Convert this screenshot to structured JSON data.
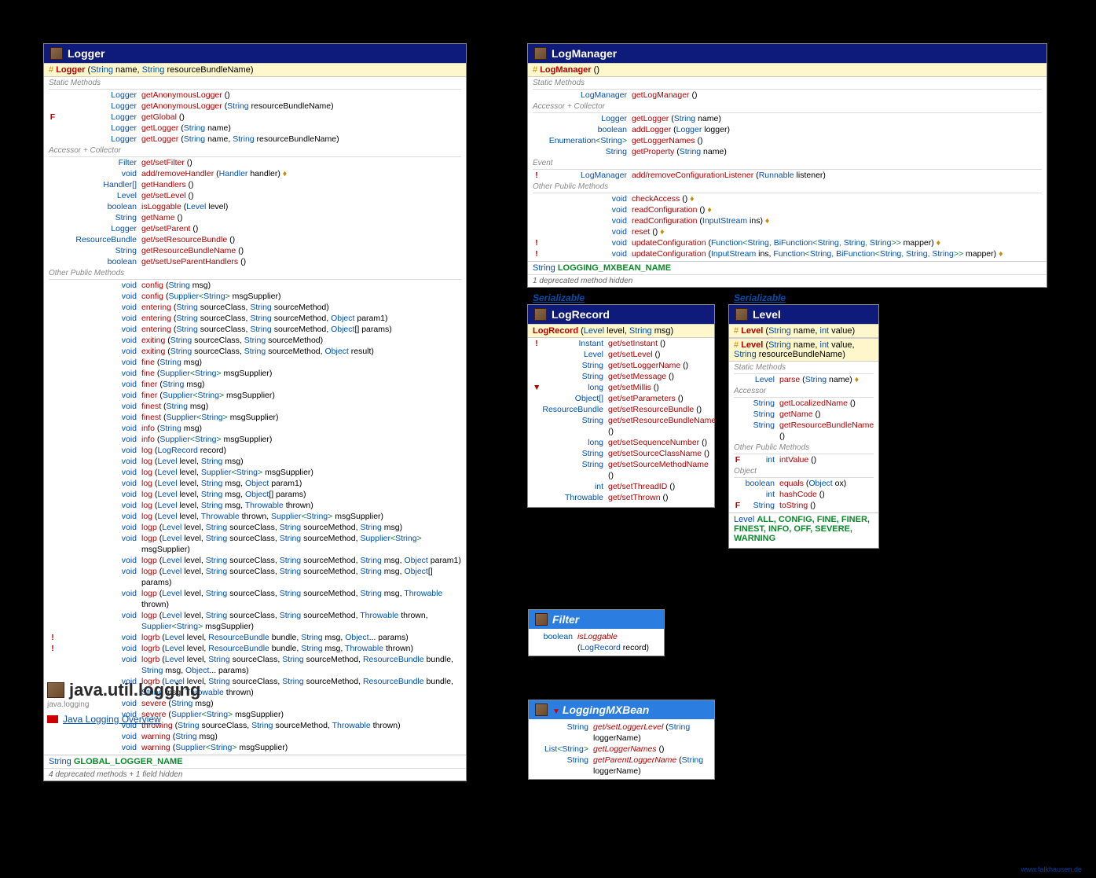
{
  "package": {
    "name": "java.util.logging",
    "module": "java.logging",
    "link": "Java Logging Overview"
  },
  "watermark": "www.falkhausen.de",
  "logger": {
    "title": "Logger",
    "ctors": [
      {
        "prefix": "#",
        "name": "Logger",
        "params": "(String name, String resourceBundleName)"
      }
    ],
    "sections": [
      {
        "title": "Static Methods",
        "rows": [
          {
            "m": "",
            "rt": "Logger",
            "name": "getAnonymousLogger",
            "params": " ()"
          },
          {
            "m": "",
            "rt": "Logger",
            "name": "getAnonymousLogger",
            "params": " (String resourceBundleName)"
          },
          {
            "m": "F",
            "rt": "Logger",
            "name": "getGlobal",
            "params": " ()"
          },
          {
            "m": "",
            "rt": "Logger",
            "name": "getLogger",
            "params": " (String name)"
          },
          {
            "m": "",
            "rt": "Logger",
            "name": "getLogger",
            "params": " (String name, String resourceBundleName)"
          }
        ]
      },
      {
        "title": "Accessor + Collector",
        "rows": [
          {
            "m": "",
            "rt": "Filter",
            "name": "get/setFilter",
            "params": " ()"
          },
          {
            "m": "",
            "rt": "void",
            "name": "add/removeHandler",
            "params": " (Handler handler) ♦"
          },
          {
            "m": "",
            "rt": "Handler[]",
            "name": "getHandlers",
            "params": " ()"
          },
          {
            "m": "",
            "rt": "Level",
            "name": "get/setLevel",
            "params": " ()"
          },
          {
            "m": "",
            "rt": "boolean",
            "name": "isLoggable",
            "params": " (Level level)"
          },
          {
            "m": "",
            "rt": "String",
            "name": "getName",
            "params": " ()"
          },
          {
            "m": "",
            "rt": "Logger",
            "name": "get/setParent",
            "params": " ()"
          },
          {
            "m": "",
            "rt": "ResourceBundle",
            "name": "get/setResourceBundle",
            "params": " ()"
          },
          {
            "m": "",
            "rt": "String",
            "name": "getResourceBundleName",
            "params": " ()"
          },
          {
            "m": "",
            "rt": "boolean",
            "name": "get/setUseParentHandlers",
            "params": " ()"
          }
        ]
      },
      {
        "title": "Other Public Methods",
        "rows": [
          {
            "m": "",
            "rt": "void",
            "name": "config",
            "params": " (String msg)"
          },
          {
            "m": "",
            "rt": "void",
            "name": "config",
            "params": " (Supplier<String> msgSupplier)"
          },
          {
            "m": "",
            "rt": "void",
            "name": "entering",
            "params": " (String sourceClass, String sourceMethod)"
          },
          {
            "m": "",
            "rt": "void",
            "name": "entering",
            "params": " (String sourceClass, String sourceMethod, Object param1)"
          },
          {
            "m": "",
            "rt": "void",
            "name": "entering",
            "params": " (String sourceClass, String sourceMethod, Object[] params)"
          },
          {
            "m": "",
            "rt": "void",
            "name": "exiting",
            "params": " (String sourceClass, String sourceMethod)"
          },
          {
            "m": "",
            "rt": "void",
            "name": "exiting",
            "params": " (String sourceClass, String sourceMethod, Object result)"
          },
          {
            "m": "",
            "rt": "void",
            "name": "fine",
            "params": " (String msg)"
          },
          {
            "m": "",
            "rt": "void",
            "name": "fine",
            "params": " (Supplier<String> msgSupplier)"
          },
          {
            "m": "",
            "rt": "void",
            "name": "finer",
            "params": " (String msg)"
          },
          {
            "m": "",
            "rt": "void",
            "name": "finer",
            "params": " (Supplier<String> msgSupplier)"
          },
          {
            "m": "",
            "rt": "void",
            "name": "finest",
            "params": " (String msg)"
          },
          {
            "m": "",
            "rt": "void",
            "name": "finest",
            "params": " (Supplier<String> msgSupplier)"
          },
          {
            "m": "",
            "rt": "void",
            "name": "info",
            "params": " (String msg)"
          },
          {
            "m": "",
            "rt": "void",
            "name": "info",
            "params": " (Supplier<String> msgSupplier)"
          },
          {
            "m": "",
            "rt": "void",
            "name": "log",
            "params": " (LogRecord record)"
          },
          {
            "m": "",
            "rt": "void",
            "name": "log",
            "params": " (Level level, String msg)"
          },
          {
            "m": "",
            "rt": "void",
            "name": "log",
            "params": " (Level level, Supplier<String> msgSupplier)"
          },
          {
            "m": "",
            "rt": "void",
            "name": "log",
            "params": " (Level level, String msg, Object param1)"
          },
          {
            "m": "",
            "rt": "void",
            "name": "log",
            "params": " (Level level, String msg, Object[] params)"
          },
          {
            "m": "",
            "rt": "void",
            "name": "log",
            "params": " (Level level, String msg, Throwable thrown)"
          },
          {
            "m": "",
            "rt": "void",
            "name": "log",
            "params": " (Level level, Throwable thrown, Supplier<String> msgSupplier)"
          },
          {
            "m": "",
            "rt": "void",
            "name": "logp",
            "params": " (Level level, String sourceClass, String sourceMethod, String msg)"
          },
          {
            "m": "",
            "rt": "void",
            "name": "logp",
            "params": " (Level level, String sourceClass, String sourceMethod, Supplier<String> msgSupplier)"
          },
          {
            "m": "",
            "rt": "void",
            "name": "logp",
            "params": " (Level level, String sourceClass, String sourceMethod, String msg, Object param1)"
          },
          {
            "m": "",
            "rt": "void",
            "name": "logp",
            "params": " (Level level, String sourceClass, String sourceMethod, String msg, Object[] params)"
          },
          {
            "m": "",
            "rt": "void",
            "name": "logp",
            "params": " (Level level, String sourceClass, String sourceMethod, String msg, Throwable thrown)"
          },
          {
            "m": "",
            "rt": "void",
            "name": "logp",
            "params": " (Level level, String sourceClass, String sourceMethod, Throwable thrown, Supplier<String> msgSupplier)"
          },
          {
            "m": "!",
            "rt": "void",
            "name": "logrb",
            "params": " (Level level, ResourceBundle bundle, String msg, Object... params)"
          },
          {
            "m": "!",
            "rt": "void",
            "name": "logrb",
            "params": " (Level level, ResourceBundle bundle, String msg, Throwable thrown)"
          },
          {
            "m": "",
            "rt": "void",
            "name": "logrb",
            "params": " (Level level, String sourceClass, String sourceMethod, ResourceBundle bundle, String msg, Object... params)"
          },
          {
            "m": "",
            "rt": "void",
            "name": "logrb",
            "params": " (Level level, String sourceClass, String sourceMethod, ResourceBundle bundle, String msg, Throwable thrown)"
          },
          {
            "m": "",
            "rt": "void",
            "name": "severe",
            "params": " (String msg)"
          },
          {
            "m": "",
            "rt": "void",
            "name": "severe",
            "params": " (Supplier<String> msgSupplier)"
          },
          {
            "m": "",
            "rt": "void",
            "name": "throwing",
            "params": " (String sourceClass, String sourceMethod, Throwable thrown)"
          },
          {
            "m": "",
            "rt": "void",
            "name": "warning",
            "params": " (String msg)"
          },
          {
            "m": "",
            "rt": "void",
            "name": "warning",
            "params": " (Supplier<String> msgSupplier)"
          }
        ]
      }
    ],
    "const": {
      "type": "String",
      "name": "GLOBAL_LOGGER_NAME"
    },
    "footer": "4 deprecated methods + 1 field hidden"
  },
  "logmanager": {
    "title": "LogManager",
    "ctors": [
      {
        "prefix": "#",
        "name": "LogManager",
        "params": " ()"
      }
    ],
    "sections": [
      {
        "title": "Static Methods",
        "rows": [
          {
            "m": "",
            "rt": "LogManager",
            "name": "getLogManager",
            "params": " ()"
          }
        ]
      },
      {
        "title": "Accessor + Collector",
        "rows": [
          {
            "m": "",
            "rt": "Logger",
            "name": "getLogger",
            "params": " (String name)"
          },
          {
            "m": "",
            "rt": "boolean",
            "name": "addLogger",
            "params": " (Logger logger)"
          },
          {
            "m": "",
            "rt": "Enumeration<String>",
            "name": "getLoggerNames",
            "params": " ()"
          },
          {
            "m": "",
            "rt": "String",
            "name": "getProperty",
            "params": " (String name)"
          }
        ]
      },
      {
        "title": "Event",
        "rows": [
          {
            "m": "!",
            "rt": "LogManager",
            "name": "add/removeConfigurationListener",
            "params": " (Runnable listener)"
          }
        ]
      },
      {
        "title": "Other Public Methods",
        "rows": [
          {
            "m": "",
            "rt": "void",
            "name": "checkAccess",
            "params": " () ♦"
          },
          {
            "m": "",
            "rt": "void",
            "name": "readConfiguration",
            "params": " () ♦"
          },
          {
            "m": "",
            "rt": "void",
            "name": "readConfiguration",
            "params": " (InputStream ins) ♦"
          },
          {
            "m": "",
            "rt": "void",
            "name": "reset",
            "params": " () ♦"
          },
          {
            "m": "!",
            "rt": "void",
            "name": "updateConfiguration",
            "params": " (Function<String, BiFunction<String, String, String>> mapper) ♦"
          },
          {
            "m": "!",
            "rt": "void",
            "name": "updateConfiguration",
            "params": " (InputStream ins, Function<String, BiFunction<String, String, String>> mapper) ♦"
          }
        ]
      }
    ],
    "const": {
      "type": "String",
      "name": "LOGGING_MXBEAN_NAME"
    },
    "footer": "1 deprecated method hidden"
  },
  "logrecord": {
    "serial": "Serializable",
    "title": "LogRecord",
    "ctors": [
      {
        "prefix": "",
        "name": "LogRecord",
        "params": " (Level level, String msg)"
      }
    ],
    "rows": [
      {
        "m": "!",
        "rt": "Instant",
        "name": "get/setInstant",
        "params": " ()"
      },
      {
        "m": "",
        "rt": "Level",
        "name": "get/setLevel",
        "params": " ()"
      },
      {
        "m": "",
        "rt": "String",
        "name": "get/setLoggerName",
        "params": " ()"
      },
      {
        "m": "",
        "rt": "String",
        "name": "get/setMessage",
        "params": " ()"
      },
      {
        "m": "▼",
        "rt": "long",
        "name": "get/setMillis",
        "params": " ()"
      },
      {
        "m": "",
        "rt": "Object[]",
        "name": "get/setParameters",
        "params": " ()"
      },
      {
        "m": "",
        "rt": "ResourceBundle",
        "name": "get/setResourceBundle",
        "params": " ()"
      },
      {
        "m": "",
        "rt": "String",
        "name": "get/setResourceBundleName",
        "params": " ()"
      },
      {
        "m": "",
        "rt": "long",
        "name": "get/setSequenceNumber",
        "params": " ()"
      },
      {
        "m": "",
        "rt": "String",
        "name": "get/setSourceClassName",
        "params": " ()"
      },
      {
        "m": "",
        "rt": "String",
        "name": "get/setSourceMethodName",
        "params": " ()"
      },
      {
        "m": "",
        "rt": "int",
        "name": "get/setThreadID",
        "params": " ()"
      },
      {
        "m": "",
        "rt": "Throwable",
        "name": "get/setThrown",
        "params": " ()"
      }
    ]
  },
  "level": {
    "serial": "Serializable",
    "title": "Level",
    "ctors": [
      {
        "prefix": "#",
        "name": "Level",
        "params": " (String name, int value)"
      },
      {
        "prefix": "#",
        "name": "Level",
        "params": " (String name, int value, String resourceBundleName)"
      }
    ],
    "sections": [
      {
        "title": "Static Methods",
        "rows": [
          {
            "m": "",
            "rt": "Level",
            "name": "parse",
            "params": " (String name) ♦"
          }
        ]
      },
      {
        "title": "Accessor",
        "rows": [
          {
            "m": "",
            "rt": "String",
            "name": "getLocalizedName",
            "params": " ()"
          },
          {
            "m": "",
            "rt": "String",
            "name": "getName",
            "params": " ()"
          },
          {
            "m": "",
            "rt": "String",
            "name": "getResourceBundleName",
            "params": " ()"
          }
        ]
      },
      {
        "title": "Other Public Methods",
        "rows": [
          {
            "m": "F",
            "rt": "int",
            "name": "intValue",
            "params": " ()"
          }
        ]
      },
      {
        "title": "Object",
        "rows": [
          {
            "m": "",
            "rt": "boolean",
            "name": "equals",
            "params": " (Object ox)"
          },
          {
            "m": "",
            "rt": "int",
            "name": "hashCode",
            "params": " ()"
          },
          {
            "m": "F",
            "rt": "String",
            "name": "toString",
            "params": " ()"
          }
        ]
      }
    ],
    "const": {
      "type": "Level",
      "name": "ALL, CONFIG, FINE, FINER, FINEST, INFO, OFF, SEVERE, WARNING"
    }
  },
  "filter": {
    "title": "Filter",
    "rows": [
      {
        "m": "",
        "rt": "boolean",
        "name": "isLoggable",
        "params": " (LogRecord record)",
        "italic": true
      }
    ]
  },
  "mxbean": {
    "title": "LoggingMXBean",
    "rows": [
      {
        "m": "",
        "rt": "String",
        "name": "get/setLoggerLevel",
        "params": " (String loggerName)",
        "italic": true
      },
      {
        "m": "",
        "rt": "List<String>",
        "name": "getLoggerNames",
        "params": " ()",
        "italic": true
      },
      {
        "m": "",
        "rt": "String",
        "name": "getParentLoggerName",
        "params": " (String loggerName)",
        "italic": true
      }
    ]
  }
}
